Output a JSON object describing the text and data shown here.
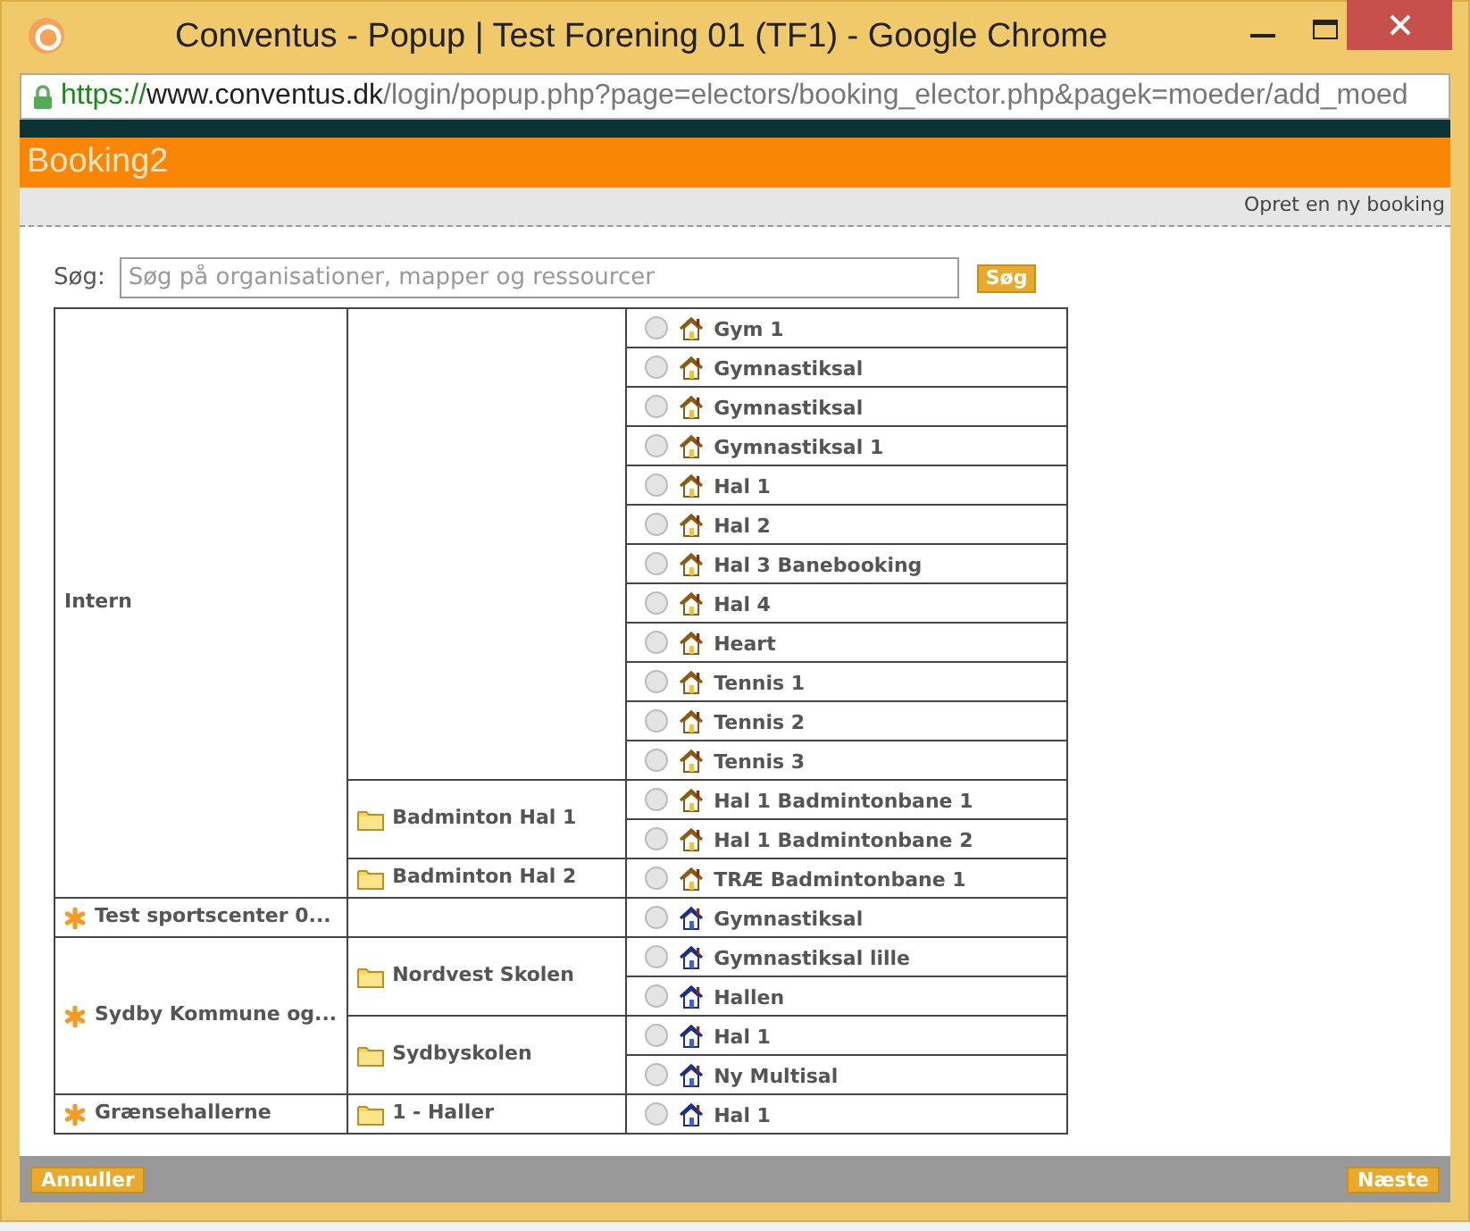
{
  "window": {
    "title": "Conventus - Popup | Test Forening 01 (TF1) - Google Chrome"
  },
  "address_bar": {
    "scheme": "https://",
    "host": "www.conventus.dk",
    "path": "/login/popup.php?page=electors/booking_elector.php&pagek=moeder/add_moed"
  },
  "header": {
    "title": "Booking2"
  },
  "toolbar": {
    "link": "Opret en ny booking"
  },
  "search": {
    "label": "Søg:",
    "placeholder": "Søg på organisationer, mapper og ressourcer",
    "button": "Søg"
  },
  "organizations": [
    {
      "label": "Intern",
      "kind": "internal",
      "folders": [
        {
          "resources": [
            {
              "label": "Gym 1",
              "selected": false
            },
            {
              "label": "Gymnastiksal",
              "selected": false
            },
            {
              "label": "Gymnastiksal",
              "selected": false
            },
            {
              "label": "Gymnastiksal 1",
              "selected": false
            },
            {
              "label": "Hal 1",
              "selected": false
            },
            {
              "label": "Hal 2",
              "selected": false
            },
            {
              "label": "Hal 3 Banebooking",
              "selected": false
            },
            {
              "label": "Hal 4",
              "selected": false
            },
            {
              "label": "Heart",
              "selected": false
            },
            {
              "label": "Tennis 1",
              "selected": false
            },
            {
              "label": "Tennis 2",
              "selected": false
            },
            {
              "label": "Tennis 3",
              "selected": false
            }
          ]
        },
        {
          "label": "Badminton Hal 1",
          "resources": [
            {
              "label": "Hal 1 Badmintonbane 1",
              "selected": false
            },
            {
              "label": "Hal 1 Badmintonbane 2",
              "selected": false
            }
          ]
        },
        {
          "label": "Badminton Hal 2",
          "resources": [
            {
              "label": "TRÆ Badmintonbane 1",
              "selected": false
            }
          ]
        }
      ]
    },
    {
      "label": "Test sportscenter 0...",
      "kind": "external",
      "folders": [
        {
          "resources": [
            {
              "label": "Gymnastiksal",
              "selected": false
            }
          ]
        }
      ]
    },
    {
      "label": "Sydby Kommune og...",
      "kind": "external",
      "folders": [
        {
          "label": "Nordvest Skolen",
          "resources": [
            {
              "label": "Gymnastiksal lille",
              "selected": false
            },
            {
              "label": "Hallen",
              "selected": false
            }
          ]
        },
        {
          "label": "Sydbyskolen",
          "resources": [
            {
              "label": "Hal 1",
              "selected": false
            },
            {
              "label": "Ny Multisal",
              "selected": false
            }
          ]
        }
      ]
    },
    {
      "label": "Grænsehallerne",
      "kind": "external",
      "folders": [
        {
          "label": "1 - Haller",
          "resources": [
            {
              "label": "Hal 1",
              "selected": false
            }
          ]
        }
      ]
    }
  ],
  "footer": {
    "cancel": "Annuller",
    "next": "Næste"
  }
}
